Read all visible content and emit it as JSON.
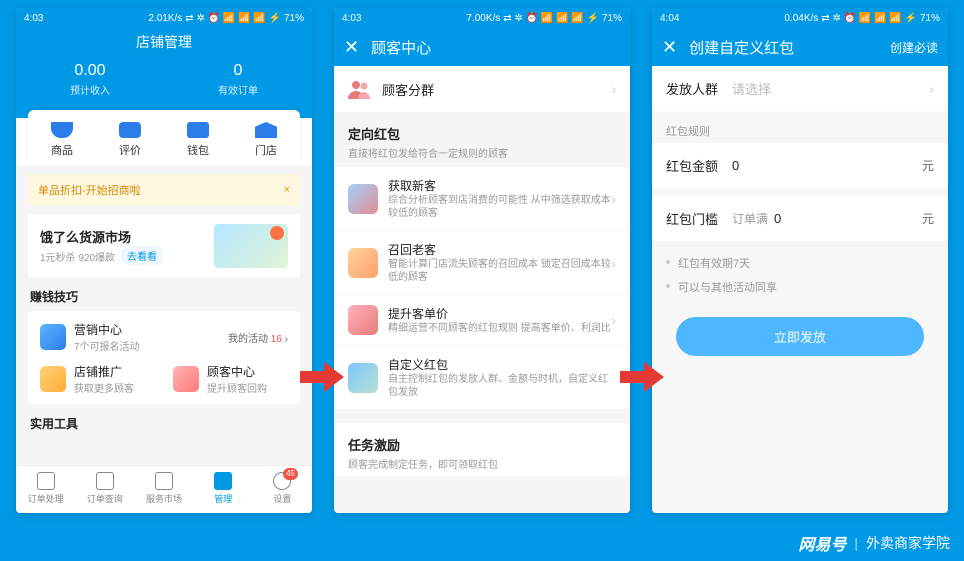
{
  "statusbar": {
    "time1": "4:03",
    "time2": "4:03",
    "time3": "4:04",
    "net1": "2.01K/s",
    "net2": "7.00K/s",
    "net3": "0.04K/s",
    "battery": "71%",
    "icons": "⇄ ✲ ⏰ 📶 📶 📶 ⚡"
  },
  "s1": {
    "title": "店铺管理",
    "stats": [
      {
        "value": "0.00",
        "label": "预计收入"
      },
      {
        "value": "0",
        "label": "有效订单"
      }
    ],
    "tabs": [
      {
        "label": "商品",
        "color": "#2b7de9"
      },
      {
        "label": "评价",
        "color": "#2b7de9"
      },
      {
        "label": "钱包",
        "color": "#2b7de9"
      },
      {
        "label": "门店",
        "color": "#2b7de9"
      }
    ],
    "notice": "单品折扣-开始招商啦",
    "notice_close": "×",
    "banner": {
      "title": "饿了么货源市场",
      "sub": "1元秒杀 920爆款",
      "btn": "去看看"
    },
    "sec1_title": "赚钱技巧",
    "sec1_row1": {
      "title": "营销中心",
      "sub": "7个可报名活动",
      "link_pre": "我的活动 ",
      "link_num": "16",
      "link_suf": " ›"
    },
    "sec1_row2a": {
      "title": "店铺推广",
      "sub": "获取更多顾客"
    },
    "sec1_row2b": {
      "title": "顾客中心",
      "sub": "提升顾客回购"
    },
    "sec2_title": "实用工具",
    "nav": [
      {
        "label": "订单处理"
      },
      {
        "label": "订单查询"
      },
      {
        "label": "服务市场"
      },
      {
        "label": "管理",
        "active": true
      },
      {
        "label": "设置",
        "badge": "45"
      }
    ]
  },
  "s2": {
    "title": "顾客中心",
    "group_cell": "顾客分群",
    "sec1": {
      "title": "定向红包",
      "sub": "直接将红包发给符合一定规则的顾客"
    },
    "items": [
      {
        "title": "获取新客",
        "sub": "综合分析顾客到店消费的可能性 从中筛选获取成本较低的顾客",
        "bg": "linear-gradient(135deg,#a3cfff,#e08f8f)"
      },
      {
        "title": "召回老客",
        "sub": "智能计算门店流失顾客的召回成本 锁定召回成本较低的顾客",
        "bg": "linear-gradient(135deg,#ffd59e,#ff9e6d)"
      },
      {
        "title": "提升客单价",
        "sub": "精细运营不同顾客的红包规则 提高客单价、利润比",
        "bg": "linear-gradient(135deg,#ffb3ba,#e87a7a)"
      },
      {
        "title": "自定义红包",
        "sub": "自主控制红包的发放人群、金额与时机，自定义红包发放",
        "bg": "linear-gradient(135deg,#7cc6ff,#b8e0d2)"
      }
    ],
    "sec2": {
      "title": "任务激励",
      "sub": "顾客完成制定任务，即可领取红包"
    }
  },
  "s3": {
    "title": "创建自定义红包",
    "action": "创建必读",
    "rows": {
      "audience_lbl": "发放人群",
      "audience_val": "请选择",
      "rule_title": "红包规则",
      "amount_lbl": "红包金额",
      "amount_val": "0",
      "amount_unit": "元",
      "threshold_lbl": "红包门槛",
      "threshold_pre": "订单满",
      "threshold_val": "0",
      "threshold_unit": "元"
    },
    "bullets": [
      "红包有效期7天",
      "可以与其他活动同享"
    ],
    "submit": "立即发放"
  },
  "watermark": {
    "logo": "网易号",
    "text": "外卖商家学院"
  }
}
